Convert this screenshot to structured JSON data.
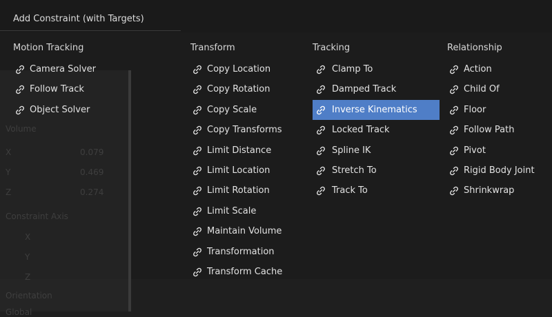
{
  "header": {
    "title": "Add Constraint (with Targets)"
  },
  "background_panel": {
    "labels": [
      "Volume",
      "X",
      "0.079",
      "Y",
      "0.469",
      "Z",
      "0.274",
      "Constraint Axis",
      "X",
      "Y",
      "Z",
      "Orientation",
      "Global"
    ]
  },
  "columns": {
    "motion_tracking": {
      "heading": "Motion Tracking",
      "items": [
        "Camera Solver",
        "Follow Track",
        "Object Solver"
      ]
    },
    "transform": {
      "heading": "Transform",
      "items": [
        "Copy Location",
        "Copy Rotation",
        "Copy Scale",
        "Copy Transforms",
        "Limit Distance",
        "Limit Location",
        "Limit Rotation",
        "Limit Scale",
        "Maintain Volume",
        "Transformation",
        "Transform Cache"
      ]
    },
    "tracking": {
      "heading": "Tracking",
      "items": [
        "Clamp To",
        "Damped Track",
        "Inverse Kinematics",
        "Locked Track",
        "Spline IK",
        "Stretch To",
        "Track To"
      ],
      "active_item": "Inverse Kinematics"
    },
    "relationship": {
      "heading": "Relationship",
      "items": [
        "Action",
        "Child Of",
        "Floor",
        "Follow Path",
        "Pivot",
        "Rigid Body Joint",
        "Shrinkwrap"
      ]
    }
  },
  "icon": "constraint-link-icon",
  "colors": {
    "highlight": "#4f7ec7",
    "background": "#1f1f1f"
  }
}
